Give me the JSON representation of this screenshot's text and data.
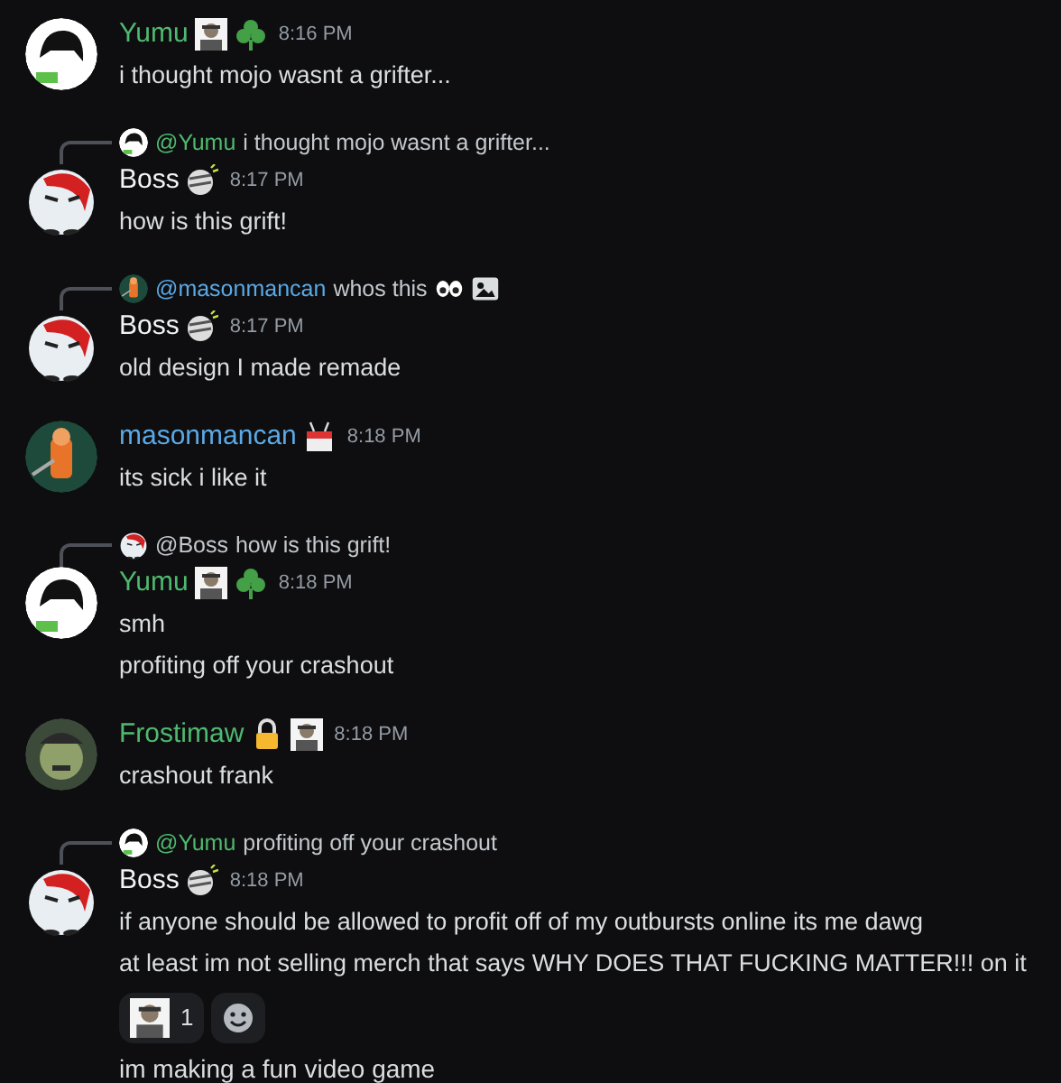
{
  "messages": [
    {
      "avatar": {
        "kind": "yumu"
      },
      "author": "Yumu",
      "color": "#4fb96f",
      "badges": [
        {
          "kind": "portrait"
        },
        {
          "kind": "clover"
        }
      ],
      "time": "8:16 PM",
      "lines": [
        "i thought mojo wasnt a grifter..."
      ]
    },
    {
      "reply": {
        "avatar": {
          "kind": "yumu"
        },
        "mention": "@Yumu",
        "color": "#4fb96f",
        "text": "i thought mojo wasnt a grifter..."
      },
      "avatar": {
        "kind": "boss"
      },
      "author": "Boss",
      "color": "#f2f3f5",
      "badges": [
        {
          "kind": "mummy"
        }
      ],
      "time": "8:17 PM",
      "lines": [
        "how is this grift!"
      ]
    },
    {
      "reply": {
        "avatar": {
          "kind": "mason"
        },
        "mention": "@masonmancan",
        "color": "#5aa9e6",
        "text": "whos this",
        "icons": [
          {
            "kind": "eyes"
          },
          {
            "kind": "image"
          }
        ]
      },
      "avatar": {
        "kind": "boss"
      },
      "author": "Boss",
      "color": "#f2f3f5",
      "badges": [
        {
          "kind": "mummy"
        }
      ],
      "time": "8:17 PM",
      "lines": [
        "old design I made remade"
      ]
    },
    {
      "avatar": {
        "kind": "mason"
      },
      "author": "masonmancan",
      "color": "#5aa9e6",
      "badges": [
        {
          "kind": "calendar"
        }
      ],
      "time": "8:18 PM",
      "lines": [
        "its sick i like it"
      ]
    },
    {
      "reply": {
        "avatar": {
          "kind": "boss"
        },
        "mention": "@Boss",
        "color": "#c4c9ce",
        "text": "how is this grift!"
      },
      "avatar": {
        "kind": "yumu"
      },
      "author": "Yumu",
      "color": "#4fb96f",
      "badges": [
        {
          "kind": "portrait"
        },
        {
          "kind": "clover"
        }
      ],
      "time": "8:18 PM",
      "lines": [
        "smh",
        "profiting off your crashout"
      ]
    },
    {
      "avatar": {
        "kind": "frost"
      },
      "author": "Frostimaw",
      "color": "#4fb96f",
      "badges": [
        {
          "kind": "lock"
        },
        {
          "kind": "portrait"
        }
      ],
      "time": "8:18 PM",
      "lines": [
        "crashout frank"
      ]
    },
    {
      "reply": {
        "avatar": {
          "kind": "yumu"
        },
        "mention": "@Yumu",
        "color": "#4fb96f",
        "text": "profiting off your crashout"
      },
      "avatar": {
        "kind": "boss"
      },
      "author": "Boss",
      "color": "#f2f3f5",
      "badges": [
        {
          "kind": "mummy"
        }
      ],
      "time": "8:18 PM",
      "lines": [
        "if anyone should be allowed to profit off of my outbursts online its me dawg",
        "at least im not selling merch that says WHY DOES THAT FUCKING MATTER!!! on it"
      ],
      "reactions": [
        {
          "kind": "portrait",
          "count": "1"
        },
        {
          "kind": "add"
        }
      ],
      "after": [
        "im making a fun video game"
      ]
    }
  ]
}
